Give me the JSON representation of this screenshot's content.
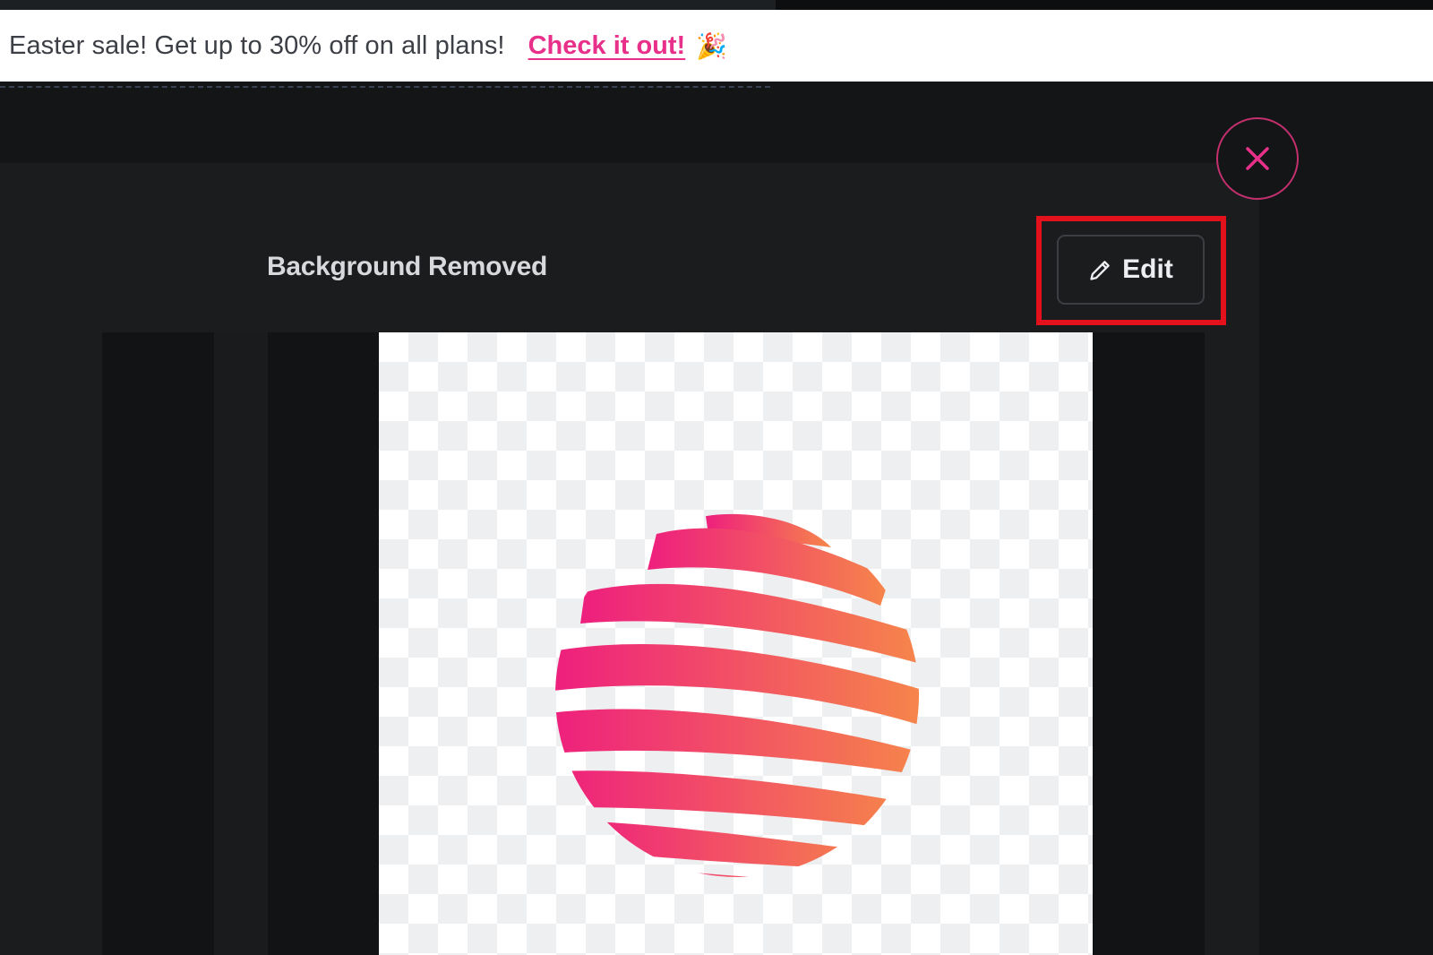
{
  "banner": {
    "text": "Easter sale! Get up to 30% off on all plans!",
    "link": "Check it out!",
    "emoji": "🎉"
  },
  "panel": {
    "title": "Background Removed",
    "edit_label": "Edit"
  },
  "icons": {
    "close": "close-icon",
    "edit": "pencil-icon",
    "preview": "globe-logo-image"
  },
  "colors": {
    "accent_pink": "#e8308a",
    "close_ring": "#c3306d",
    "highlight_red": "#e3111c",
    "background": "#141517"
  }
}
